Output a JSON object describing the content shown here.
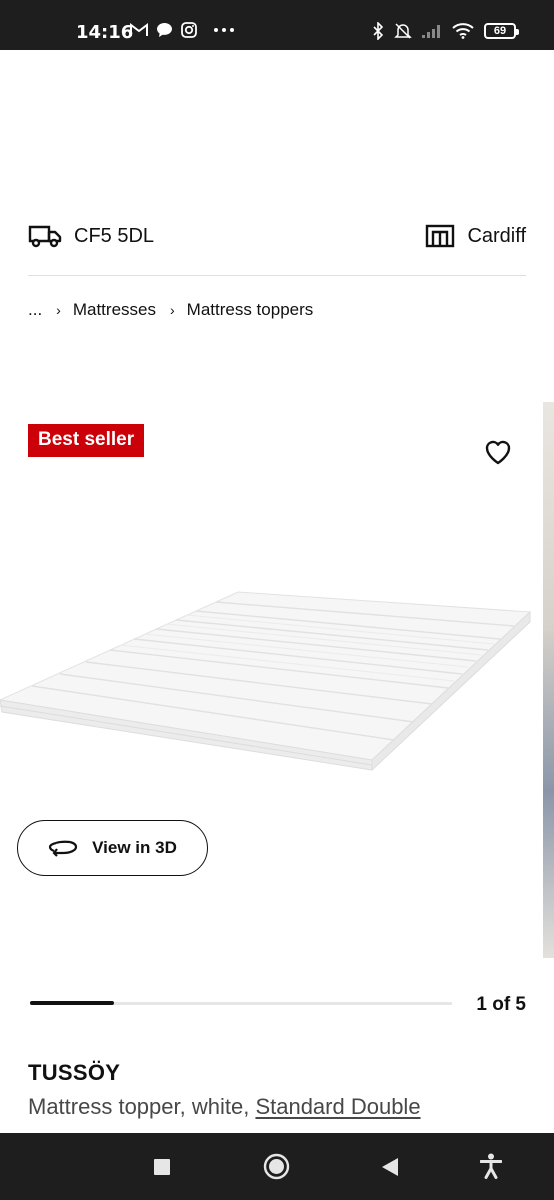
{
  "status_bar": {
    "time": "14:16",
    "battery": "69",
    "left_icons": [
      "gmail-icon",
      "chat-icon",
      "instagram-icon",
      "more-dots-icon"
    ],
    "right_icons": [
      "bluetooth-icon",
      "mute-icon",
      "signal-icon",
      "wifi-icon",
      "battery-icon"
    ]
  },
  "location": {
    "postcode": "CF5 5DL",
    "store": "Cardiff",
    "delivery_icon": "truck-icon",
    "store_icon": "store-icon"
  },
  "breadcrumb": {
    "ellipsis": "...",
    "items": [
      "Mattresses",
      "Mattress toppers"
    ]
  },
  "product": {
    "badge": "Best seller",
    "view_3d_label": "View in 3D",
    "image_index": 1,
    "image_total": 5,
    "counter_text": "1 of 5",
    "name": "TUSSÖY",
    "description_prefix": "Mattress topper, white, ",
    "size_link": "Standard Double"
  },
  "colors": {
    "badge_bg": "#cc0008",
    "system_bar": "#1e1e1e"
  },
  "nav_bar": {
    "buttons": [
      "recents-square-icon",
      "home-circle-icon",
      "back-triangle-icon",
      "accessibility-icon"
    ]
  }
}
